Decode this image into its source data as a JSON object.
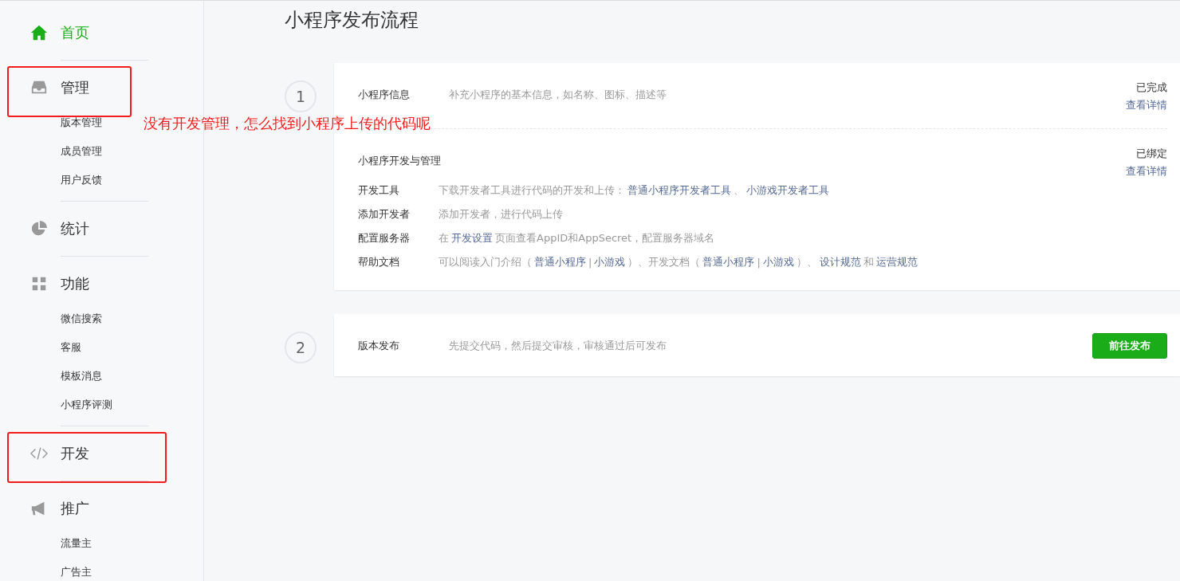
{
  "sidebar": {
    "sections": [
      {
        "label": "首页",
        "selected": true,
        "highlighted": false
      },
      {
        "label": "管理",
        "selected": false,
        "highlighted": true,
        "children": [
          "版本管理",
          "成员管理",
          "用户反馈"
        ]
      },
      {
        "label": "统计",
        "selected": false,
        "highlighted": false
      },
      {
        "label": "功能",
        "selected": false,
        "highlighted": false,
        "children": [
          "微信搜索",
          "客服",
          "模板消息",
          "小程序评测"
        ]
      },
      {
        "label": "开发",
        "selected": false,
        "highlighted": true
      },
      {
        "label": "推广",
        "selected": false,
        "highlighted": false,
        "children": [
          "流量主",
          "广告主"
        ]
      }
    ]
  },
  "annotation": {
    "text": "没有开发管理，怎么找到小程序上传的代码呢"
  },
  "page_title": "小程序发布流程",
  "steps": [
    {
      "number": "1",
      "blocks": [
        {
          "title": "小程序信息",
          "description": "补充小程序的基本信息，如名称、图标、描述等",
          "status": "已完成",
          "link": "查看详情"
        },
        {
          "title": "小程序开发与管理",
          "status": "已绑定",
          "link": "查看详情",
          "rows": [
            {
              "label": "开发工具",
              "parts": [
                {
                  "kind": "text",
                  "text": "下载开发者工具进行代码的开发和上传："
                },
                {
                  "kind": "link",
                  "text": "普通小程序开发者工具"
                },
                {
                  "kind": "text",
                  "text": "、"
                },
                {
                  "kind": "link",
                  "text": "小游戏开发者工具"
                }
              ]
            },
            {
              "label": "添加开发者",
              "parts": [
                {
                  "kind": "text",
                  "text": "添加开发者，进行代码上传"
                }
              ]
            },
            {
              "label": "配置服务器",
              "parts": [
                {
                  "kind": "text",
                  "text": "在"
                },
                {
                  "kind": "link",
                  "text": "开发设置"
                },
                {
                  "kind": "text",
                  "text": "页面查看AppID和AppSecret，配置服务器域名"
                }
              ]
            },
            {
              "label": "帮助文档",
              "parts": [
                {
                  "kind": "text",
                  "text": "可以阅读入门介绍（"
                },
                {
                  "kind": "link",
                  "text": "普通小程序"
                },
                {
                  "kind": "text",
                  "text": "|"
                },
                {
                  "kind": "link",
                  "text": "小游戏"
                },
                {
                  "kind": "text",
                  "text": "）、开发文档（"
                },
                {
                  "kind": "link",
                  "text": "普通小程序"
                },
                {
                  "kind": "text",
                  "text": "|"
                },
                {
                  "kind": "link",
                  "text": "小游戏"
                },
                {
                  "kind": "text",
                  "text": "）、"
                },
                {
                  "kind": "link",
                  "text": "设计规范"
                },
                {
                  "kind": "text",
                  "text": "和"
                },
                {
                  "kind": "link",
                  "text": "运营规范"
                }
              ]
            }
          ]
        }
      ]
    },
    {
      "number": "2",
      "blocks": [
        {
          "title": "版本发布",
          "description": "先提交代码，然后提交审核，审核通过后可发布",
          "button": "前往发布"
        }
      ]
    }
  ]
}
